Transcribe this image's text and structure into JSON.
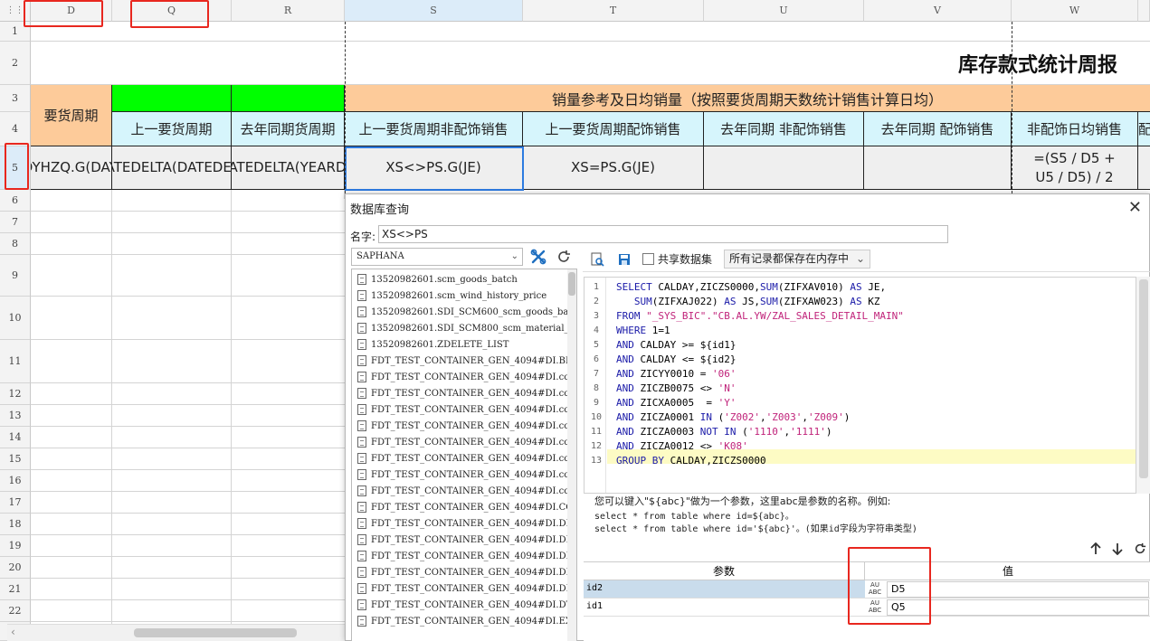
{
  "columns": [
    "D",
    "Q",
    "R",
    "S",
    "T",
    "U",
    "V",
    "W"
  ],
  "rows": [
    "1",
    "2",
    "3",
    "4",
    "5",
    "6",
    "7",
    "8",
    "9",
    "10",
    "11",
    "12",
    "13",
    "14",
    "15",
    "16",
    "17",
    "18",
    "19",
    "20",
    "21",
    "22"
  ],
  "sheet": {
    "report_title": "库存款式统计周报",
    "row3": {
      "d": "要货周期",
      "sales_header": "销量参考及日均销量（按照要货周期天数统计销售计算日均）"
    },
    "row4": {
      "q": "上一要货周期",
      "r": "去年同期货周期",
      "s": "上一要货周期非配饰销售",
      "t": "上一要货周期配饰销售",
      "u": "去年同期  非配饰销售",
      "v": "去年同期  配饰销售",
      "w": "非配饰日均销售",
      "x": "配"
    },
    "row5": {
      "d": "MDYHZQ.G(DAYS)",
      "q": "=DATEDELTA(DATEDELTA(",
      "r": "=DATEDELTA(YEARDELT",
      "s": "XS<>PS.G(JE)",
      "t": "XS=PS.G(JE)",
      "w": "=(S5 / D5 + U5 / D5) / 2"
    }
  },
  "dialog": {
    "title": "数据库查询",
    "name_label": "名字:",
    "name_value": "XS<>PS",
    "datasource": "SAPHANA",
    "shared_dataset_label": "共享数据集",
    "memory_option": "所有记录都保存在内存中",
    "tables": [
      "13520982601.scm_goods_batch",
      "13520982601.scm_wind_history_price",
      "13520982601.SDI_SCM600_scm_goods_bat",
      "13520982601.SDI_SCM800_scm_material_",
      "13520982601.ZDELETE_LIST",
      "FDT_TEST_CONTAINER_GEN_4094#DI.BLOB_",
      "FDT_TEST_CONTAINER_GEN_4094#DI.com.s",
      "FDT_TEST_CONTAINER_GEN_4094#DI.com.s",
      "FDT_TEST_CONTAINER_GEN_4094#DI.com.s",
      "FDT_TEST_CONTAINER_GEN_4094#DI.com.s",
      "FDT_TEST_CONTAINER_GEN_4094#DI.com.s",
      "FDT_TEST_CONTAINER_GEN_4094#DI.com.s",
      "FDT_TEST_CONTAINER_GEN_4094#DI.com.s",
      "FDT_TEST_CONTAINER_GEN_4094#DI.com.s",
      "FDT_TEST_CONTAINER_GEN_4094#DI.CONFIG",
      "FDT_TEST_CONTAINER_GEN_4094#DI.DEPLO",
      "FDT_TEST_CONTAINER_GEN_4094#DI.DEPST",
      "FDT_TEST_CONTAINER_GEN_4094#DI.DEPST",
      "FDT_TEST_CONTAINER_GEN_4094#DI.DEPST",
      "FDT_TEST_CONTAINER_GEN_4094#DI.DEPST",
      "FDT_TEST_CONTAINER_GEN_4094#DI.DTC_L",
      "FDT_TEST_CONTAINER_GEN_4094#DI.EXPAN"
    ],
    "sql_lines": [
      [
        {
          "t": "SELECT",
          "c": "kw"
        },
        {
          "t": " CALDAY,ZICZS0000,"
        },
        {
          "t": "SUM",
          "c": "kw"
        },
        {
          "t": "(ZIFXAV010) "
        },
        {
          "t": "AS",
          "c": "kw"
        },
        {
          "t": " JE,"
        }
      ],
      [
        {
          "t": "   "
        },
        {
          "t": "SUM",
          "c": "kw"
        },
        {
          "t": "(ZIFXAJ022) "
        },
        {
          "t": "AS",
          "c": "kw"
        },
        {
          "t": " JS,"
        },
        {
          "t": "SUM",
          "c": "kw"
        },
        {
          "t": "(ZIFXAW023) "
        },
        {
          "t": "AS",
          "c": "kw"
        },
        {
          "t": " KZ"
        }
      ],
      [
        {
          "t": "FROM",
          "c": "kw"
        },
        {
          "t": " "
        },
        {
          "t": "\"_SYS_BIC\".\"CB.AL.YW/ZAL_SALES_DETAIL_MAIN\"",
          "c": "str"
        }
      ],
      [
        {
          "t": "WHERE",
          "c": "kw"
        },
        {
          "t": " 1=1"
        }
      ],
      [
        {
          "t": "AND",
          "c": "kw"
        },
        {
          "t": " CALDAY >= ${id1}"
        }
      ],
      [
        {
          "t": "AND",
          "c": "kw"
        },
        {
          "t": " CALDAY <= ${id2}"
        }
      ],
      [
        {
          "t": "AND",
          "c": "kw"
        },
        {
          "t": " ZICYY0010 = "
        },
        {
          "t": "'06'",
          "c": "str"
        }
      ],
      [
        {
          "t": "AND",
          "c": "kw"
        },
        {
          "t": " ZICZB0075 <> "
        },
        {
          "t": "'N'",
          "c": "str"
        }
      ],
      [
        {
          "t": "AND",
          "c": "kw"
        },
        {
          "t": " ZICXA0005  = "
        },
        {
          "t": "'Y'",
          "c": "str"
        }
      ],
      [
        {
          "t": "AND",
          "c": "kw"
        },
        {
          "t": " ZICZA0001 "
        },
        {
          "t": "IN",
          "c": "kw"
        },
        {
          "t": " ("
        },
        {
          "t": "'Z002'",
          "c": "str"
        },
        {
          "t": ","
        },
        {
          "t": "'Z003'",
          "c": "str"
        },
        {
          "t": ","
        },
        {
          "t": "'Z009'",
          "c": "str"
        },
        {
          "t": ")"
        }
      ],
      [
        {
          "t": "AND",
          "c": "kw"
        },
        {
          "t": " ZICZA0003 "
        },
        {
          "t": "NOT IN",
          "c": "kw"
        },
        {
          "t": " ("
        },
        {
          "t": "'1110'",
          "c": "str"
        },
        {
          "t": ","
        },
        {
          "t": "'1111'",
          "c": "str"
        },
        {
          "t": ")"
        }
      ],
      [
        {
          "t": "AND",
          "c": "kw"
        },
        {
          "t": " ZICZA0012 <> "
        },
        {
          "t": "'K08'",
          "c": "str"
        }
      ],
      [
        {
          "t": "GROUP BY",
          "c": "kw"
        },
        {
          "t": " CALDAY,ZICZS0000"
        }
      ]
    ],
    "hint_line1": "您可以键入\"${abc}\"做为一个参数，这里abc是参数的名称。例如:",
    "hint_line2": "select * from table where id=${abc}。",
    "hint_line3": "select * from table where id='${abc}'。(如果id字段为字符串类型)",
    "param_header": "参数",
    "value_header": "值",
    "params": [
      {
        "name": "id2",
        "type": "ABC",
        "value": "D5"
      },
      {
        "name": "id1",
        "type": "ABC",
        "value": "Q5"
      }
    ]
  }
}
